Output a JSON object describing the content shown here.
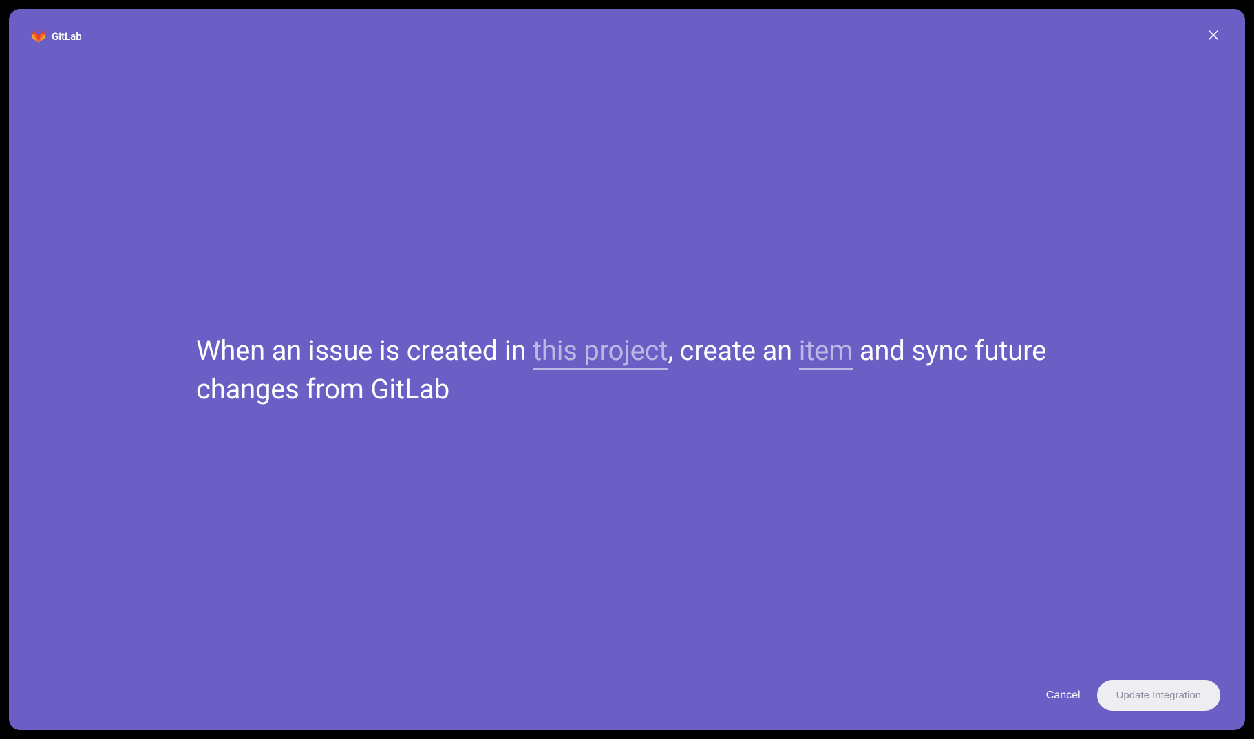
{
  "header": {
    "brand": "GitLab"
  },
  "sentence": {
    "part1": "When an issue is created in ",
    "slot1": "this project",
    "part2": ", create an ",
    "slot2": "item",
    "part3": " and sync future changes from GitLab"
  },
  "footer": {
    "cancel": "Cancel",
    "submit": "Update Integration"
  }
}
